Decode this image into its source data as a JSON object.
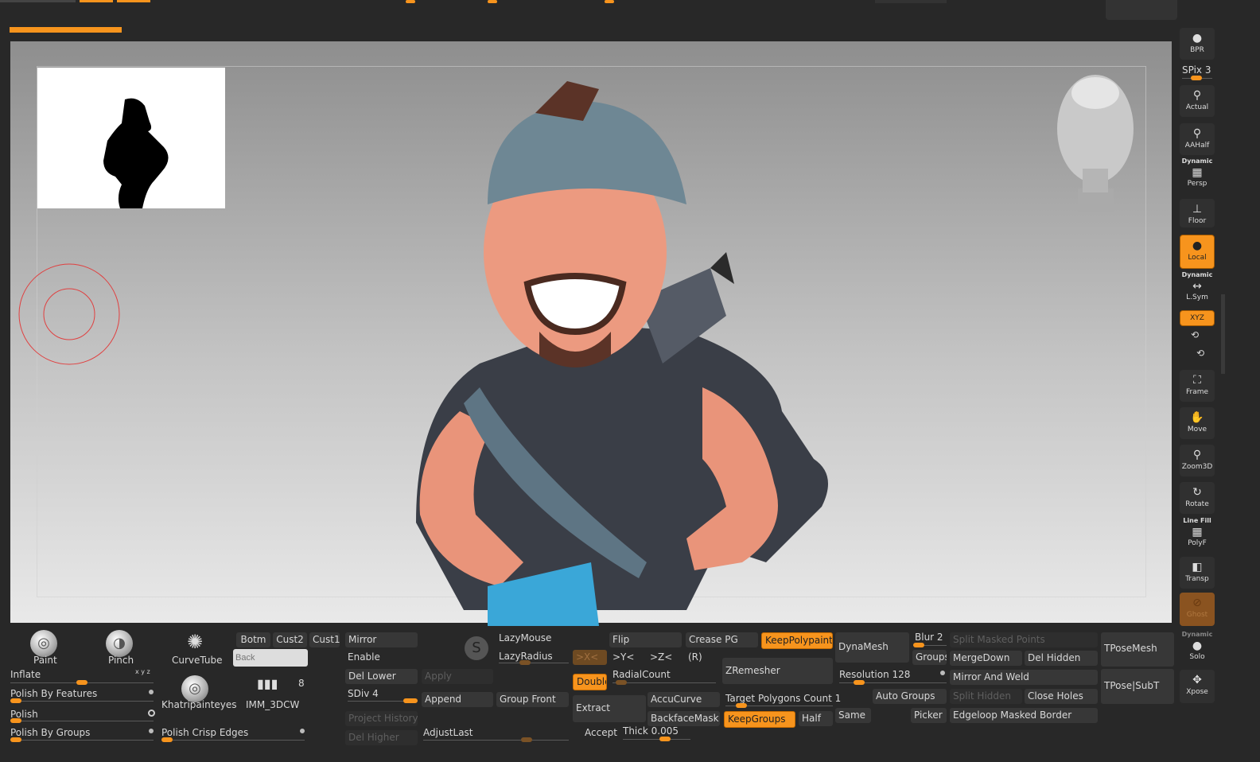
{
  "colors": {
    "accent": "#f7941d",
    "panel": "#282828"
  },
  "brushes": [
    {
      "label": "Paint"
    },
    {
      "label": "Pinch"
    },
    {
      "label": "CurveTube"
    },
    {
      "label": "Khatripainteyes"
    },
    {
      "label": "IMM_3DCW",
      "count": "8"
    }
  ],
  "sliders": {
    "inflate": "Inflate",
    "inflate_axes": "x y z",
    "polish_by_features": "Polish By Features",
    "polish": "Polish",
    "polish_by_groups": "Polish By Groups",
    "polish_crisp_edges": "Polish Crisp Edges"
  },
  "views": {
    "botm": "Botm",
    "cust2": "Cust2",
    "cust1": "Cust1",
    "back_placeholder": "Back"
  },
  "subdiv": {
    "mirror": "Mirror",
    "enable": "Enable",
    "del_lower": "Del Lower",
    "apply": "Apply",
    "sdiv": "SDiv 4",
    "append": "Append",
    "group_front": "Group Front",
    "project_history": "Project History",
    "del_higher": "Del Higher",
    "adjust_last": "AdjustLast",
    "lazy_mouse": "LazyMouse",
    "lazy_radius": "LazyRadius"
  },
  "geometry": {
    "flip": "Flip",
    "crease_pg": "Crease PG",
    "keep_polypaint": "KeepPolypaint",
    "x": ">X<",
    "y": ">Y<",
    "z": ">Z<",
    "r": "(R)",
    "zremesher": "ZRemesher",
    "double": "Double",
    "radial_count": "RadialCount",
    "extract": "Extract",
    "accucurve": "AccuCurve",
    "backface_mask": "BackfaceMask",
    "target_polygons": "Target Polygons Count 1",
    "keep_groups": "KeepGroups",
    "half": "Half",
    "accept": "Accept",
    "thick": "Thick 0.005"
  },
  "dynamesh": {
    "dynamesh": "DynaMesh",
    "blur": "Blur 2",
    "groups": "Groups",
    "resolution": "Resolution 128",
    "same": "Same",
    "auto_groups": "Auto Groups",
    "picker": "Picker"
  },
  "subtools": {
    "split_masked": "Split Masked Points",
    "merge_down": "MergeDown",
    "del_hidden": "Del Hidden",
    "mirror_weld": "Mirror And Weld",
    "split_hidden": "Split Hidden",
    "close_holes": "Close Holes",
    "edgeloop": "Edgeloop Masked Border",
    "tpose_mesh": "TPoseMesh",
    "tpose_subt": "TPose|SubT"
  },
  "shelf": {
    "bpr": "BPR",
    "spix": "SPix 3",
    "actual": "Actual",
    "aahalf": "AAHalf",
    "dynamic": "Dynamic",
    "persp": "Persp",
    "floor": "Floor",
    "local": "Local",
    "lsym": "L.Sym",
    "xyz": "XYZ",
    "frame": "Frame",
    "move": "Move",
    "zoom3d": "Zoom3D",
    "rotate": "Rotate",
    "line_fill": "Line Fill",
    "polyf": "PolyF",
    "transp": "Transp",
    "ghost": "Ghost",
    "solo": "Solo",
    "xpose": "Xpose"
  }
}
